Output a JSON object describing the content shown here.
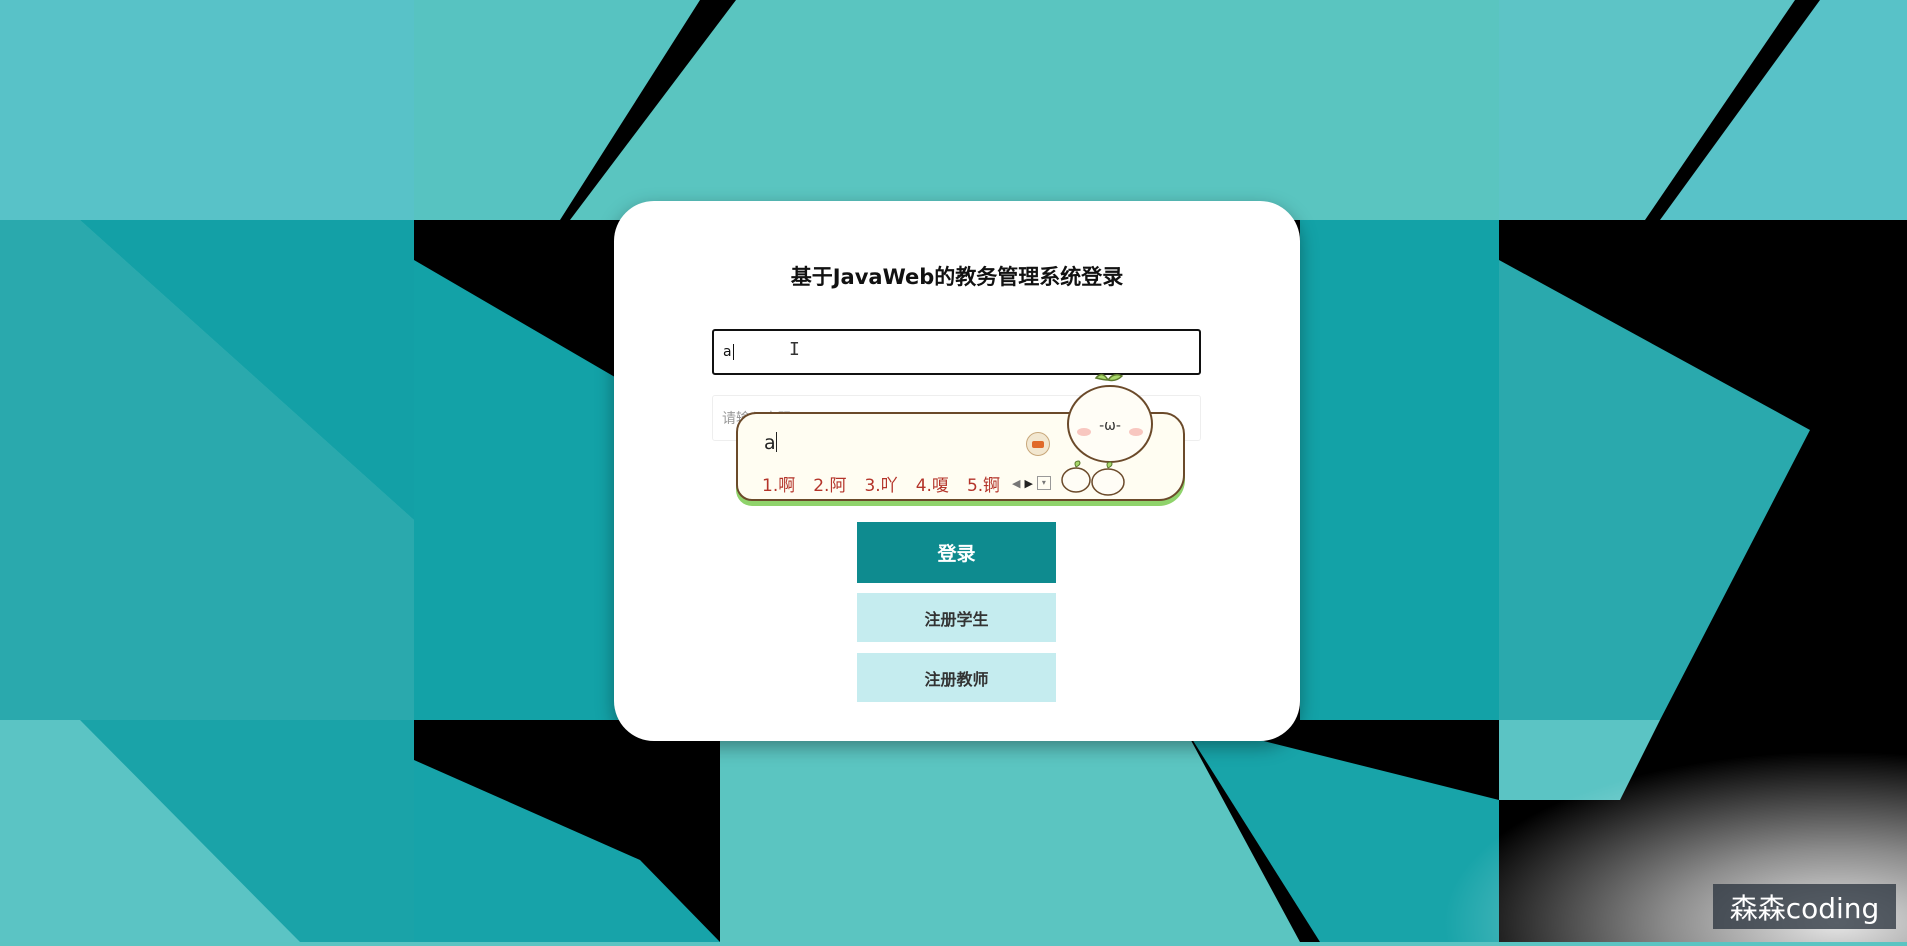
{
  "page": {
    "title": "基于JavaWeb的教务管理系统登录"
  },
  "form": {
    "username_value": "a",
    "password_placeholder": "请输入密码"
  },
  "buttons": {
    "login": "登录",
    "register_student": "注册学生",
    "register_teacher": "注册教师"
  },
  "ime": {
    "composition": "a",
    "candidates": [
      "1.啊",
      "2.阿",
      "3.吖",
      "4.嗄",
      "5.锕"
    ],
    "mascot_face": "-ω-"
  },
  "watermark": {
    "text": "森森coding"
  },
  "colors": {
    "login_button": "#0e8b8f",
    "register_button": "#c5ecef",
    "background_teal": "#5bc4c2"
  }
}
